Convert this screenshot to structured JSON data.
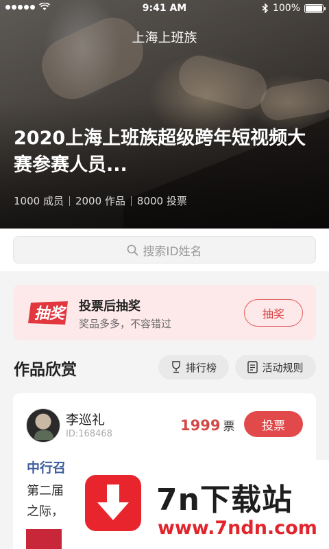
{
  "status_bar": {
    "time": "9:41 AM",
    "battery_text": "100%",
    "battery_level": 1.0
  },
  "hero": {
    "page_title": "上海上班族",
    "headline": "2020上海上班族超级跨年短视频大赛参赛人员...",
    "stats": [
      "1000 成员",
      "2000 作品",
      "8000 投票"
    ]
  },
  "search": {
    "placeholder": "搜索ID姓名"
  },
  "lottery": {
    "logo_text": "抽奖",
    "title": "投票后抽奖",
    "subtitle": "奖品多多，不容错过",
    "button": "抽奖"
  },
  "section": {
    "title": "作品欣赏",
    "rank_label": "排行榜",
    "rules_label": "活动规则"
  },
  "entry": {
    "name": "李巡礼",
    "id": "ID:168468",
    "votes": "1999",
    "votes_unit": "票",
    "vote_button": "投票",
    "work_title": "中行召",
    "desc_line1": "第二届",
    "desc_line2": "之际，"
  },
  "watermark": {
    "brand": "7n下载站",
    "url": "www.7ndn.com"
  },
  "colors": {
    "accent": "#e2494a",
    "link_blue": "#3d5d9c",
    "banner_bg": "#fde8ea"
  }
}
